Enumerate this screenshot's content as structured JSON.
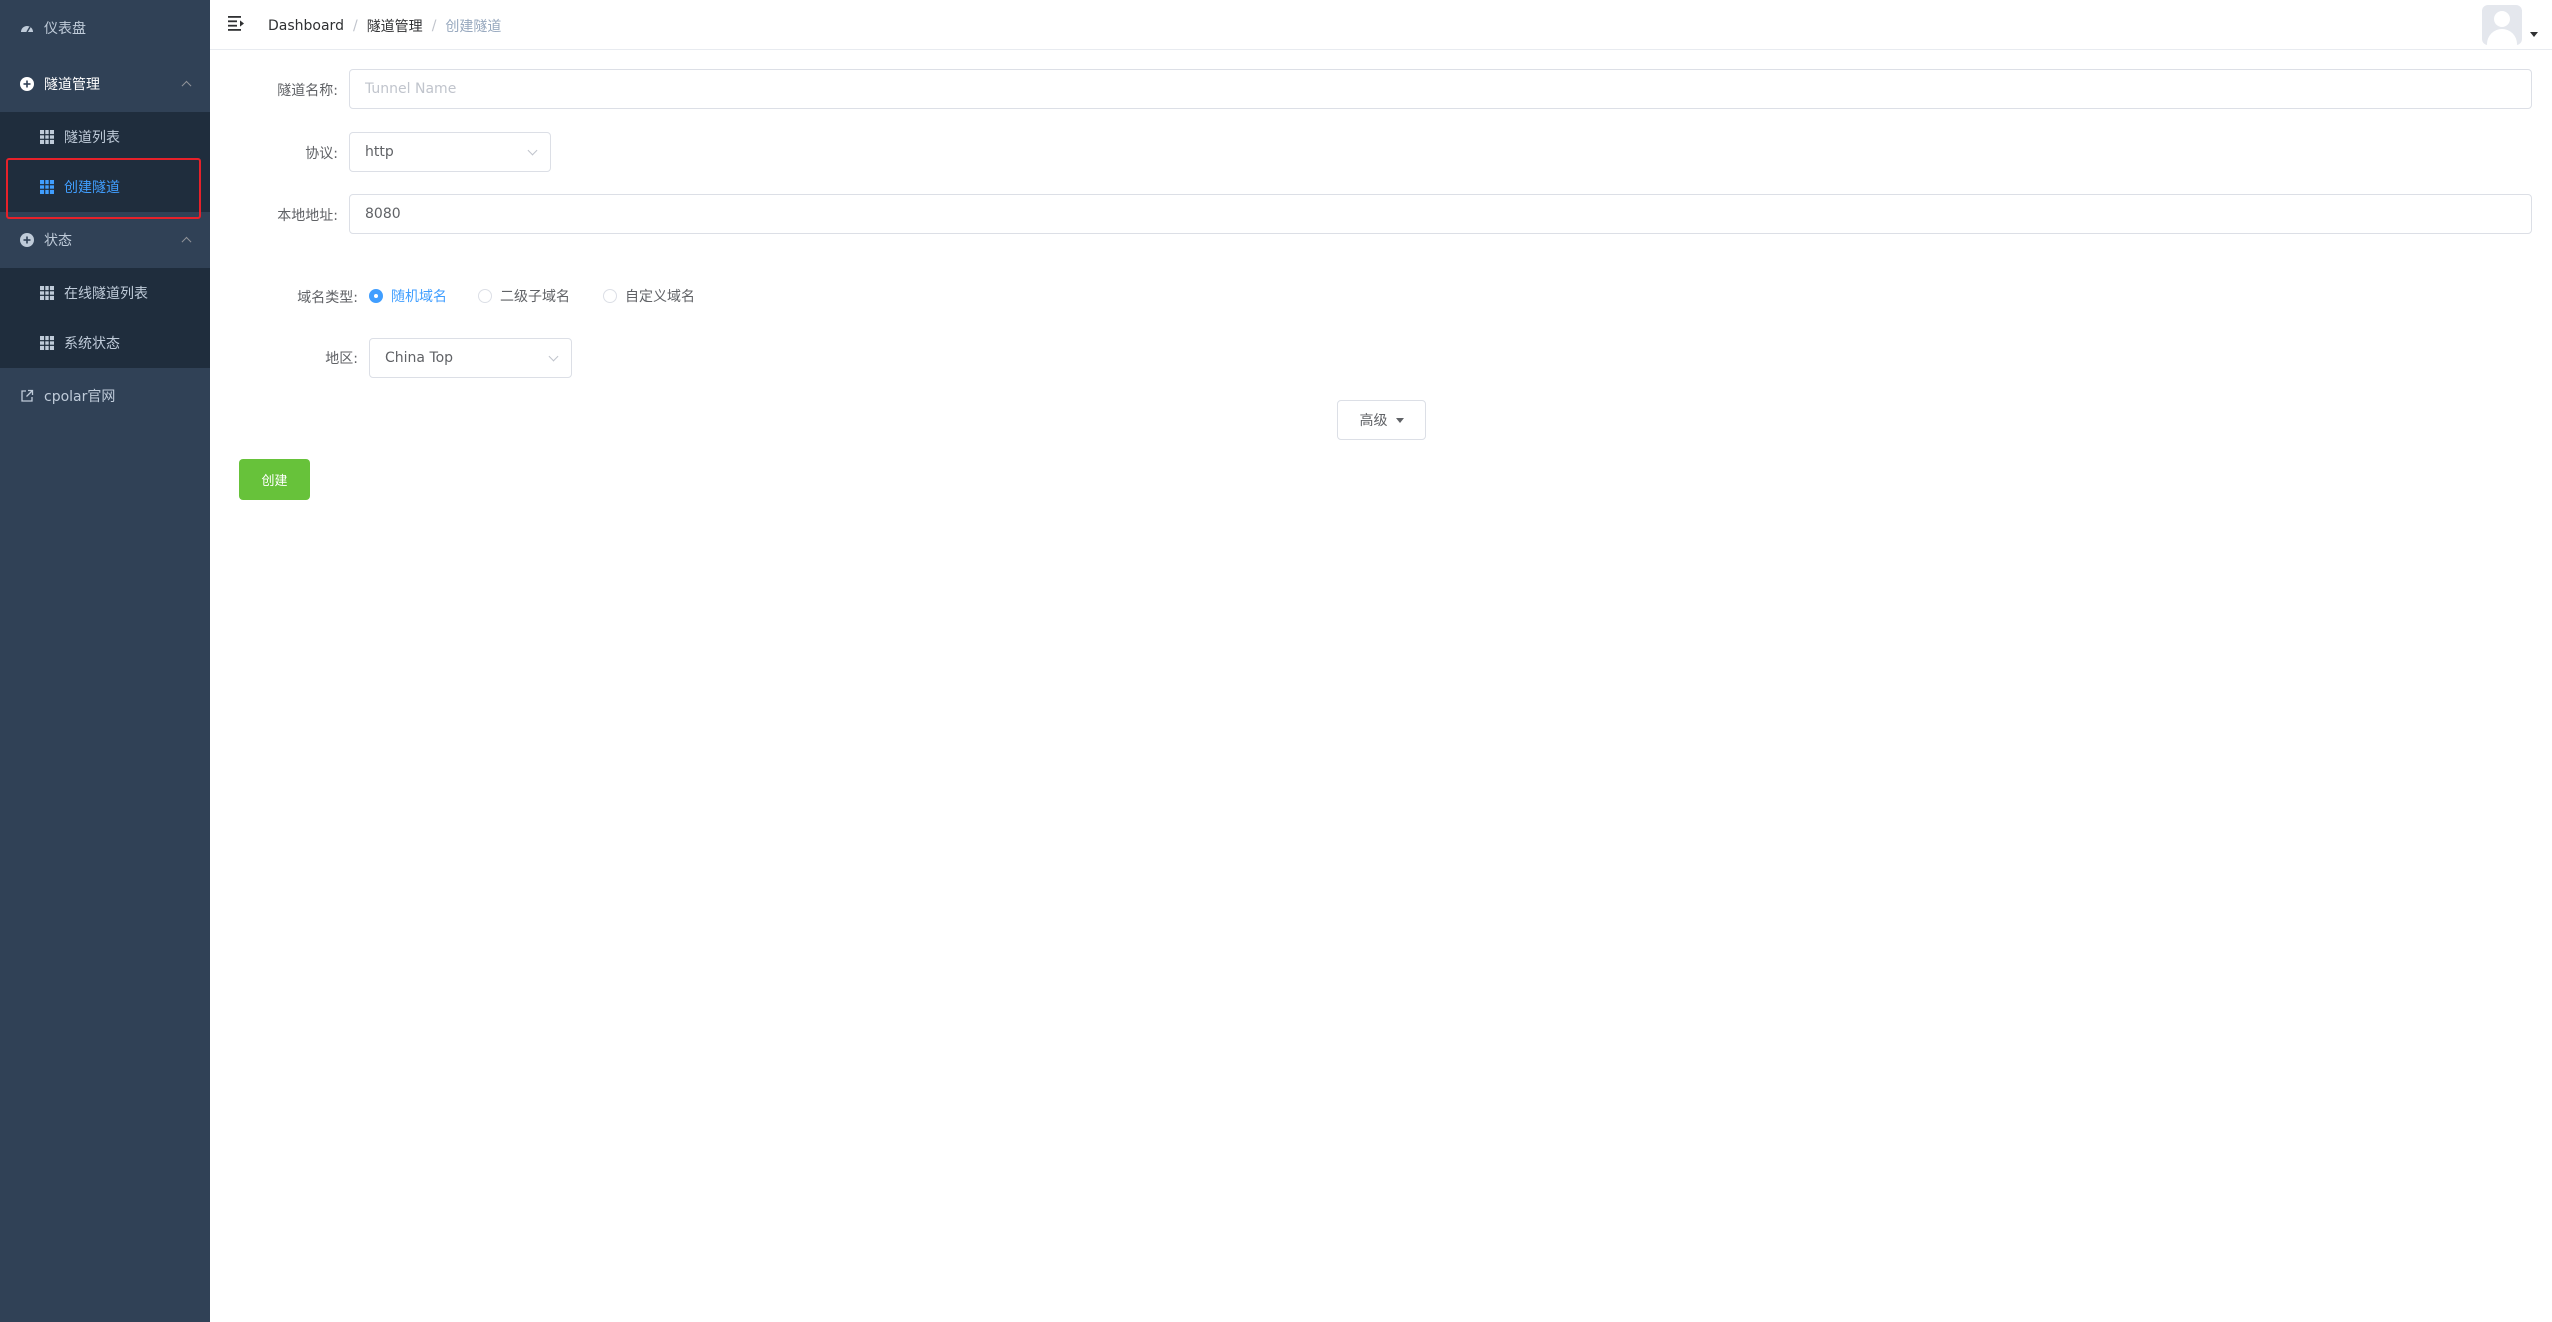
{
  "sidebar": {
    "items": [
      {
        "label": "仪表盘",
        "icon": "dashboard-icon"
      },
      {
        "label": "隧道管理",
        "icon": "plus-circle-icon"
      },
      {
        "label": "隧道列表",
        "icon": "grid-icon"
      },
      {
        "label": "创建隧道",
        "icon": "grid-icon"
      },
      {
        "label": "状态",
        "icon": "plus-circle-icon"
      },
      {
        "label": "在线隧道列表",
        "icon": "grid-icon"
      },
      {
        "label": "系统状态",
        "icon": "grid-icon"
      },
      {
        "label": "cpolar官网",
        "icon": "external-link-icon"
      }
    ],
    "active_color": "#409eff",
    "background": "#304156"
  },
  "header": {
    "breadcrumb": [
      "Dashboard",
      "隧道管理",
      "创建隧道"
    ]
  },
  "form": {
    "tunnel_name": {
      "label": "隧道名称:",
      "placeholder": "Tunnel Name",
      "value": ""
    },
    "protocol": {
      "label": "协议:",
      "value": "http"
    },
    "local_address": {
      "label": "本地地址:",
      "value": "8080"
    },
    "domain_type": {
      "label": "域名类型:",
      "options": [
        "随机域名",
        "二级子域名",
        "自定义域名"
      ],
      "selected": "随机域名"
    },
    "region": {
      "label": "地区:",
      "value": "China Top"
    },
    "advanced_label": "高级",
    "create_label": "创建"
  },
  "colors": {
    "primary": "#409eff",
    "success": "#67c23a",
    "highlight": "#e6212a"
  }
}
